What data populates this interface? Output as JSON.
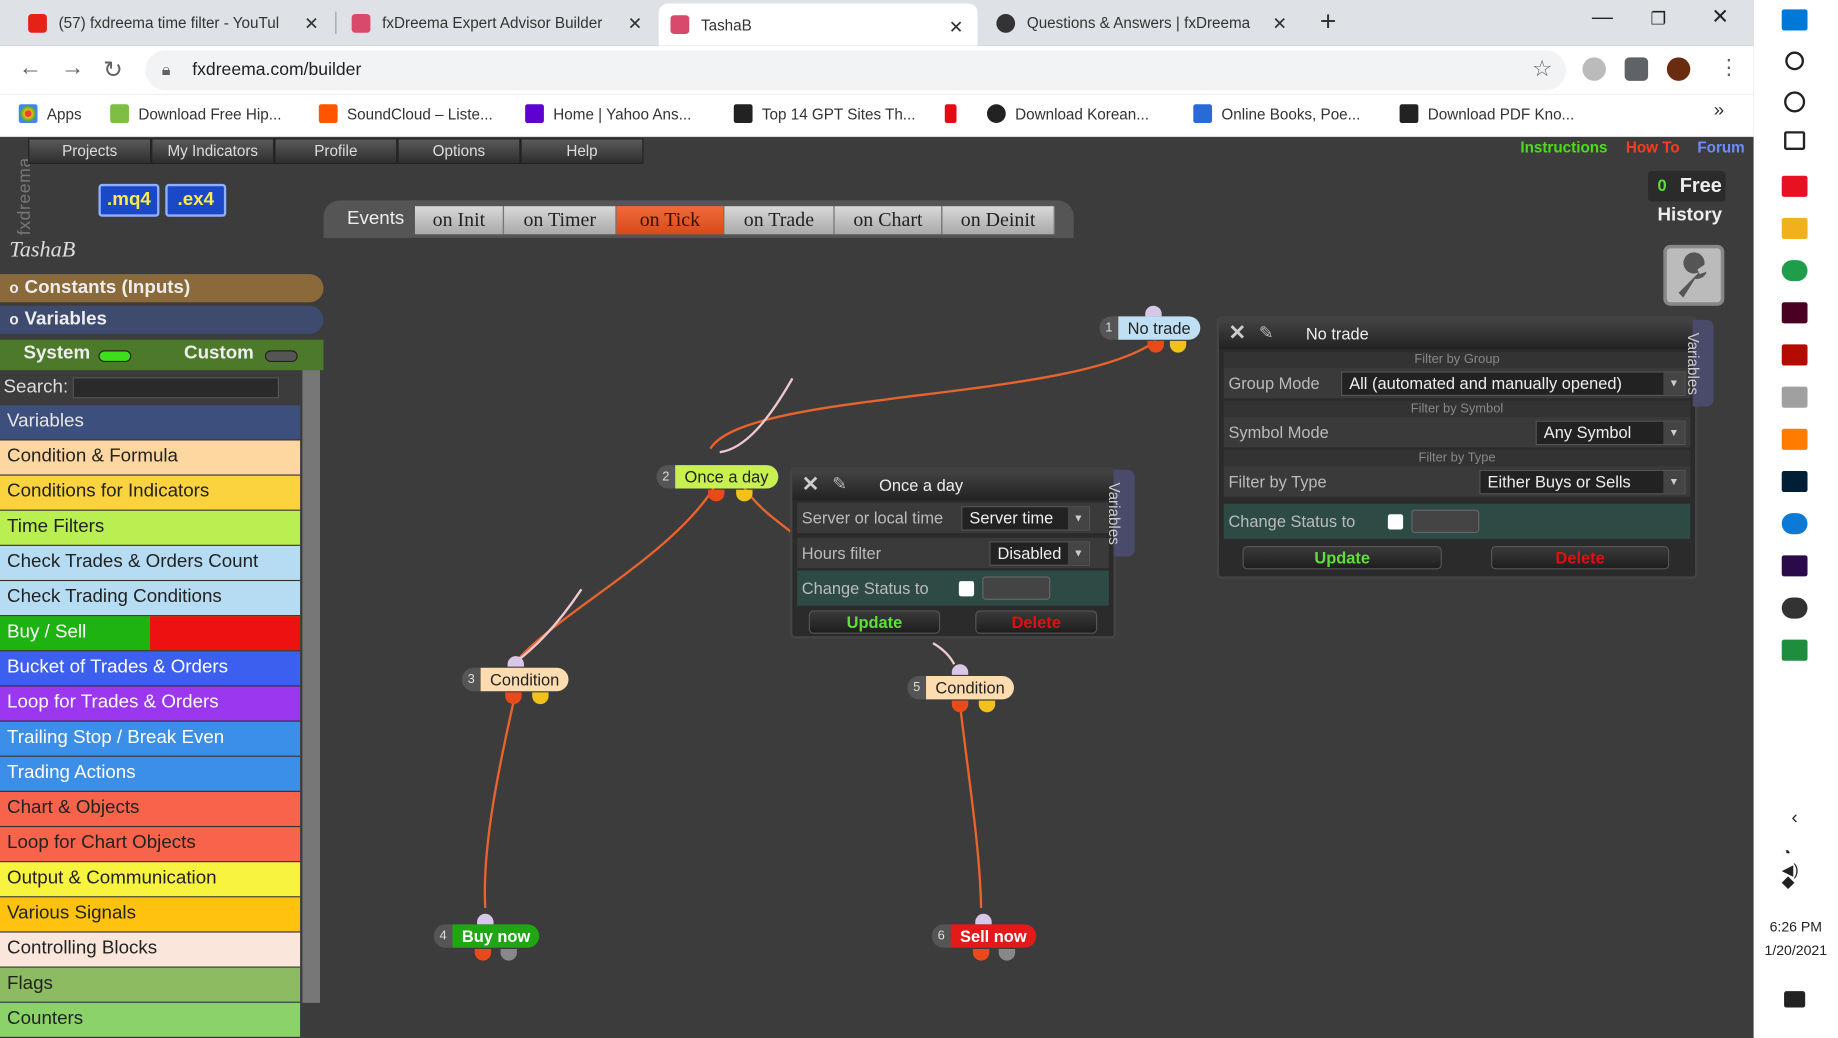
{
  "browser": {
    "tabs": [
      {
        "title": "(57) fxdreema time filter - YouTul",
        "color": "#e62117"
      },
      {
        "title": "fxDreema Expert Advisor Builder",
        "color": "#d94a6a"
      },
      {
        "title": "TashaB",
        "color": "#d94a6a"
      },
      {
        "title": "Questions & Answers | fxDreema",
        "color": "#333333"
      }
    ],
    "url": "fxdreema.com/builder",
    "bookmarks": [
      {
        "label": "Apps",
        "color": "#ea4335"
      },
      {
        "label": "Download Free Hip...",
        "color": "#7cbf43"
      },
      {
        "label": "SoundCloud – Liste...",
        "color": "#ff5500"
      },
      {
        "label": "Home | Yahoo Ans...",
        "color": "#5f01d1"
      },
      {
        "label": "Top 14 GPT Sites Th...",
        "color": "#222222"
      },
      {
        "label": "",
        "color": "#e50914"
      },
      {
        "label": "Download Korean...",
        "color": "#222222"
      },
      {
        "label": "Online Books, Poe...",
        "color": "#2a6ad8"
      },
      {
        "label": "Download PDF Kno...",
        "color": "#222222"
      }
    ],
    "bookmarks_more": "»"
  },
  "app": {
    "menu": [
      "Projects",
      "My Indicators",
      "Profile",
      "Options",
      "Help"
    ],
    "side_logo": "fxdreema",
    "file_buttons": [
      ".mq4",
      ".ex4"
    ],
    "top_links": [
      {
        "label": "Instructions",
        "color": "#4ddc1a"
      },
      {
        "label": "How To",
        "color": "#ff3b1f"
      },
      {
        "label": "Forum",
        "color": "#6f8cff"
      }
    ],
    "free": {
      "count": "0",
      "label": "Free"
    },
    "history": "History",
    "events_label": "Events",
    "event_tabs": [
      "on Init",
      "on Timer",
      "on Tick",
      "on Trade",
      "on Chart",
      "on Deinit"
    ],
    "active_event": "on Tick",
    "project_name": "TashaB",
    "constants_label": "Constants (Inputs)",
    "variables_label": "Variables",
    "system_label": "System",
    "custom_label": "Custom",
    "search_label": "Search:",
    "categories": [
      {
        "label": "Variables",
        "color": "#3d4f7c",
        "text": "#e6e6e6"
      },
      {
        "label": "Condition & Formula",
        "color": "#fed6a0",
        "text": "#222222"
      },
      {
        "label": "Conditions for Indicators",
        "color": "#fbd33f",
        "text": "#222222"
      },
      {
        "label": "Time Filters",
        "color": "#b9ef50",
        "text": "#222222"
      },
      {
        "label": "Check Trades & Orders Count",
        "color": "#b6dcf3",
        "text": "#222222"
      },
      {
        "label": "Check Trading Conditions",
        "color": "#b6dcf3",
        "text": "#222222"
      },
      {
        "label": "Buy / Sell",
        "color": "#1fb312",
        "text": "#ffffff",
        "split": "#ee1111"
      },
      {
        "label": "Bucket of Trades & Orders",
        "color": "#3d5ff0",
        "text": "#ffffff"
      },
      {
        "label": "Loop for Trades & Orders",
        "color": "#9b37ef",
        "text": "#ffffff"
      },
      {
        "label": "Trailing Stop / Break Even",
        "color": "#3c8fe8",
        "text": "#ffffff"
      },
      {
        "label": "Trading Actions",
        "color": "#3c8fe8",
        "text": "#ffffff"
      },
      {
        "label": "Chart & Objects",
        "color": "#f8644b",
        "text": "#222222"
      },
      {
        "label": "Loop for Chart Objects",
        "color": "#f8644b",
        "text": "#222222"
      },
      {
        "label": "Output & Communication",
        "color": "#f8f33e",
        "text": "#222222"
      },
      {
        "label": "Various Signals",
        "color": "#ffc20f",
        "text": "#222222"
      },
      {
        "label": "Controlling Blocks",
        "color": "#fbe6dc",
        "text": "#222222"
      },
      {
        "label": "Flags",
        "color": "#8dbb62",
        "text": "#222222"
      },
      {
        "label": "Counters",
        "color": "#8bd368",
        "text": "#222222"
      }
    ]
  },
  "nodes": [
    {
      "num": "1",
      "label": "No trade",
      "color": "#bfe0f4",
      "text": "#222222"
    },
    {
      "num": "2",
      "label": "Once a day",
      "color": "#c8f050",
      "text": "#222222"
    },
    {
      "num": "3",
      "label": "Condition",
      "color": "#fedcb0",
      "text": "#222222"
    },
    {
      "num": "4",
      "label": "Buy now",
      "color": "#1fa612",
      "text": "#ffffff"
    },
    {
      "num": "5",
      "label": "Condition",
      "color": "#fedcb0",
      "text": "#222222"
    },
    {
      "num": "6",
      "label": "Sell now",
      "color": "#e31a1a",
      "text": "#ffffff"
    }
  ],
  "panel_once": {
    "title": "Once a day",
    "server_label": "Server or local time",
    "server_value": "Server time",
    "hours_label": "Hours filter",
    "hours_value": "Disabled",
    "change_status": "Change Status to",
    "update": "Update",
    "delete": "Delete",
    "side_tab": "Variables"
  },
  "panel_notrade": {
    "title": "No trade",
    "filter_group": "Filter by Group",
    "group_label": "Group Mode",
    "group_value": "All (automated and manually opened)",
    "filter_symbol": "Filter by Symbol",
    "symbol_label": "Symbol Mode",
    "symbol_value": "Any Symbol",
    "filter_type_hdr": "Filter by Type",
    "type_label": "Filter by Type",
    "type_value": "Either Buys or Sells",
    "change_status": "Change Status to",
    "update": "Update",
    "delete": "Delete",
    "side_tab": "Variables"
  },
  "taskbar": {
    "time": "6:26 PM",
    "date": "1/20/2021"
  },
  "colors": {
    "canvas": "#3c3c3c",
    "wire": "#e8642c",
    "wire_light": "#f0c8d0",
    "update_green": "#5ee03a",
    "delete_red": "#e01010"
  }
}
